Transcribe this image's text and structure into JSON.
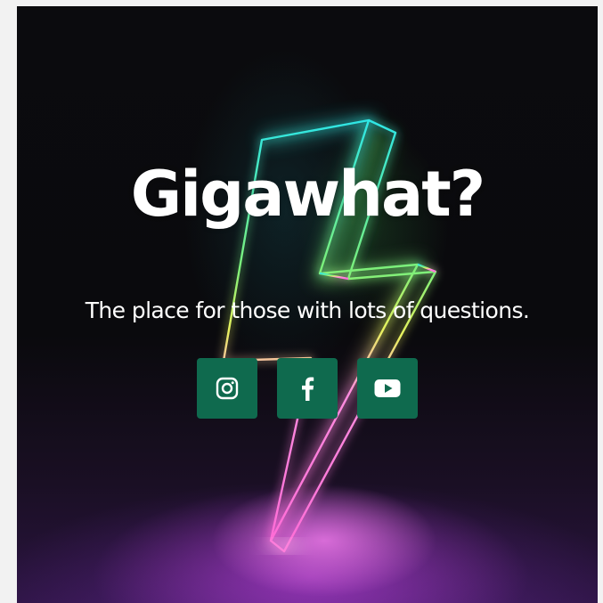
{
  "hero": {
    "headline": "Gigawhat?",
    "tagline": "The place for those with lots of questions."
  },
  "social": [
    {
      "icon": "instagram-icon",
      "color": "#0f6a4e"
    },
    {
      "icon": "facebook-icon",
      "color": "#0f6a4e"
    },
    {
      "icon": "youtube-icon",
      "color": "#0f6a4e"
    }
  ],
  "colors": {
    "page_bg": "#f2f2f2",
    "hero_bg": "#0a0a0d",
    "button_bg": "#0f6a4e",
    "text": "#ffffff",
    "neon_cyan": "#2ee6e6",
    "neon_green": "#6cf06a",
    "neon_pink": "#ff6bd6"
  }
}
